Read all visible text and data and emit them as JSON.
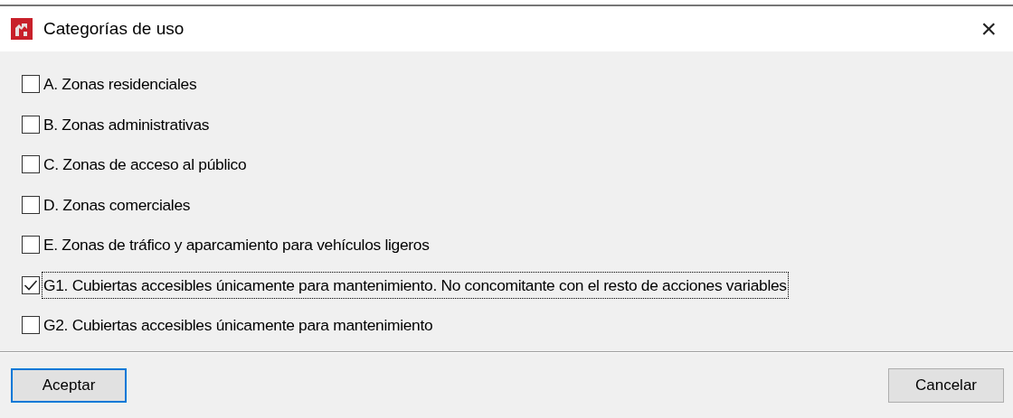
{
  "window": {
    "title": "Categorías de uso",
    "close": "×"
  },
  "options": [
    {
      "label": "A. Zonas residenciales",
      "checked": false,
      "focused": false
    },
    {
      "label": "B. Zonas administrativas",
      "checked": false,
      "focused": false
    },
    {
      "label": "C. Zonas de acceso al público",
      "checked": false,
      "focused": false
    },
    {
      "label": "D. Zonas comerciales",
      "checked": false,
      "focused": false
    },
    {
      "label": "E. Zonas de tráfico y aparcamiento para vehículos ligeros",
      "checked": false,
      "focused": false
    },
    {
      "label": "G1. Cubiertas accesibles únicamente para mantenimiento. No concomitante con el resto de acciones variables",
      "checked": true,
      "focused": true
    },
    {
      "label": "G2. Cubiertas accesibles únicamente para mantenimiento",
      "checked": false,
      "focused": false
    }
  ],
  "buttons": [
    {
      "label": "Aceptar",
      "default": true
    },
    {
      "label": "Cancelar",
      "default": false
    }
  ]
}
